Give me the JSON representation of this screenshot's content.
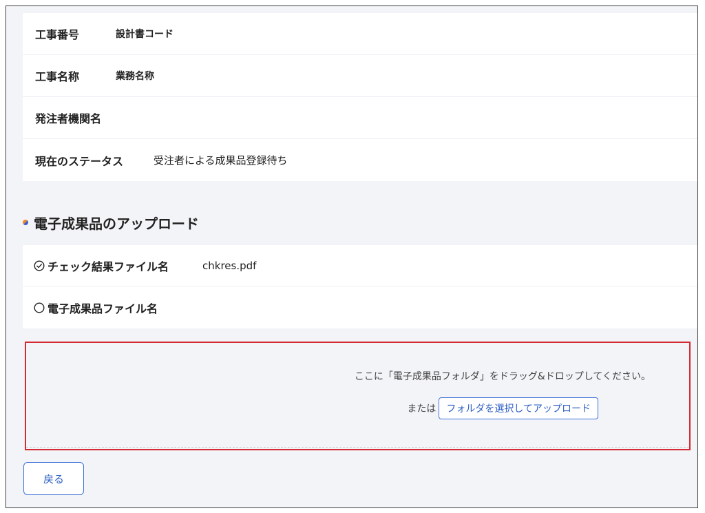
{
  "info": {
    "rows": [
      {
        "label": "工事番号",
        "value": "設計書コード"
      },
      {
        "label": "工事名称",
        "value": "業務名称"
      },
      {
        "label": "発注者機関名",
        "value": ""
      },
      {
        "label": "現在のステータス",
        "value": "受注者による成果品登録待ち"
      }
    ]
  },
  "upload_section": {
    "title": "電子成果品のアップロード",
    "files": [
      {
        "label": "チェック結果ファイル名",
        "value": "chkres.pdf",
        "status": "checked-circle-icon"
      },
      {
        "label": "電子成果品ファイル名",
        "value": "",
        "status": "empty-circle-icon"
      }
    ]
  },
  "drop_zone": {
    "instruction": "ここに「電子成果品フォルダ」をドラッグ&ドロップしてください。",
    "or_text": "または",
    "button_label": "フォルダを選択してアップロード"
  },
  "footer": {
    "back_label": "戻る"
  },
  "colors": {
    "accent": "#3d6fd6",
    "drop_border": "#d42a35",
    "background": "#f3f4f7"
  }
}
